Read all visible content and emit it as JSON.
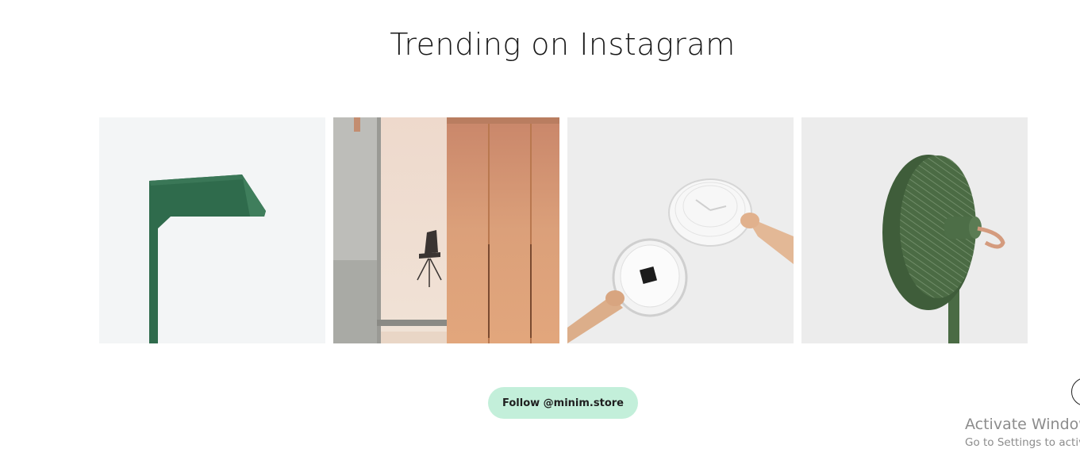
{
  "section": {
    "title": "Trending on Instagram"
  },
  "tiles": [
    {
      "name": "green-desk-lamp-photo",
      "background": "#f3f5f6"
    },
    {
      "name": "orange-wardrobe-interior-photo",
      "background": "#e9d6c6"
    },
    {
      "name": "white-wall-clock-hands-photo",
      "background": "#ededed"
    },
    {
      "name": "green-round-fan-photo",
      "background": "#ececec"
    }
  ],
  "follow_button": {
    "label": "Follow @minim.store"
  },
  "watermark": {
    "line1": "Activate Windows",
    "line2": "Go to Settings to activate Windows."
  },
  "colors": {
    "accent": "#c3efda",
    "lamp_green": "#2f6b4c",
    "fan_green": "#4a6b44",
    "wardrobe_orange": "#dca27c"
  }
}
